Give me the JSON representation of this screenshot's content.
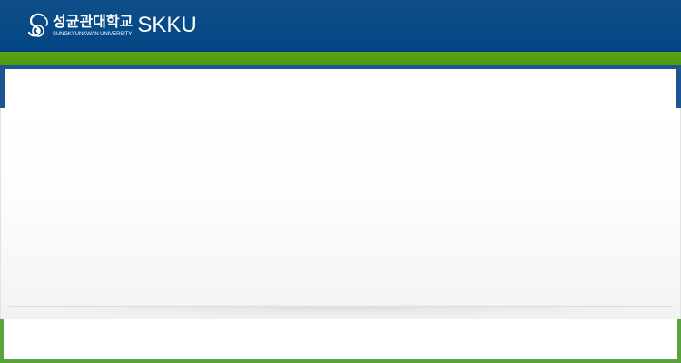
{
  "header": {
    "logo": {
      "korean_name": "성균관대학교",
      "english_name": "SUNGKYUNKWAN UNIVERSITY",
      "abbreviation": "SKKU",
      "emblem_icon": "skku-emblem-icon"
    }
  },
  "colors": {
    "header_blue": "#064a86",
    "accent_green": "#5aa316",
    "frame_blue": "#1d5593",
    "frame_green": "#5aa33a",
    "panel_background": "#f6f6f6"
  }
}
